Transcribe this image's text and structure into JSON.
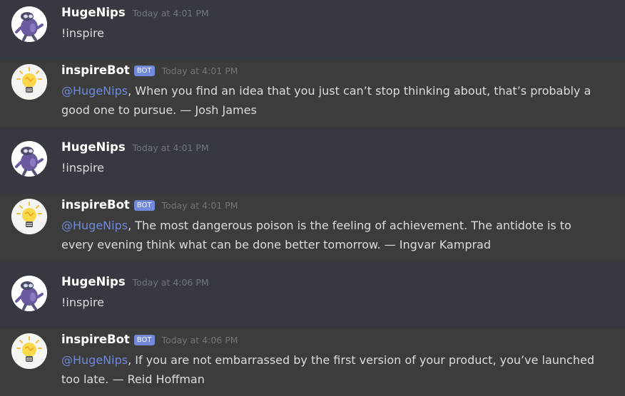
{
  "messages": [
    {
      "author": "HugeNips",
      "timestamp": "Today at 4:01 PM",
      "text": "!inspire"
    },
    {
      "author": "inspireBot",
      "badge": "BOT",
      "timestamp": "Today at 4:01 PM",
      "mention": "@HugeNips",
      "text": ", When you find an idea that you just can’t stop thinking about, that’s probably a good one to pursue. — Josh James"
    },
    {
      "author": "HugeNips",
      "timestamp": "Today at 4:01 PM",
      "text": "!inspire"
    },
    {
      "author": "inspireBot",
      "badge": "BOT",
      "timestamp": "Today at 4:01 PM",
      "mention": "@HugeNips",
      "text": ", The most dangerous poison is the feeling of achievement. The antidote is to every evening think what can be done better tomorrow. — Ingvar Kamprad"
    },
    {
      "author": "HugeNips",
      "timestamp": "Today at 4:06 PM",
      "text": "!inspire"
    },
    {
      "author": "inspireBot",
      "badge": "BOT",
      "timestamp": "Today at 4:06 PM",
      "mention": "@HugeNips",
      "text": ", If you are not embarrassed by the first version of your product, you’ve launched too late. — Reid Hoffman"
    }
  ],
  "colors": {
    "background": "#36393f",
    "bot_row_background": "#3b3c3b",
    "username": "#ffffff",
    "message_text": "#dcddde",
    "timestamp": "#72767d",
    "mention": "#7289da",
    "bot_badge": "#7289da"
  },
  "icons": {
    "user_avatar": "purple-cartoon-character-avatar",
    "bot_avatar": "lightbulb-avatar"
  }
}
